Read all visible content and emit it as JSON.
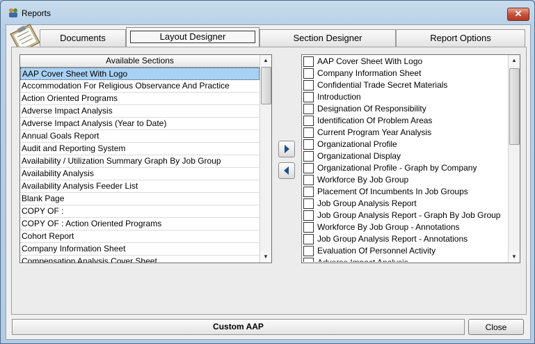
{
  "window": {
    "title": "Reports",
    "close_glyph": "✕"
  },
  "tabs": [
    {
      "label": "Documents",
      "active": false
    },
    {
      "label": "Layout Designer",
      "active": true
    },
    {
      "label": "Section Designer",
      "active": false
    },
    {
      "label": "Report Options",
      "active": false
    }
  ],
  "available": {
    "header": "Available Sections",
    "items": [
      "AAP Cover Sheet With Logo",
      "Accommodation For Religious Observance And Practice",
      "Action Oriented Programs",
      "Adverse Impact Analysis",
      "Adverse Impact Analysis (Year to Date)",
      "Annual Goals Report",
      "Audit and Reporting System",
      "Availability / Utilization Summary Graph By Job Group",
      "Availability Analysis",
      "Availability Analysis Feeder List",
      "Blank Page",
      "COPY OF :",
      "COPY OF : Action Oriented Programs",
      "Cohort Report",
      "Company Information Sheet",
      "Compensation Analysis Cover Sheet"
    ],
    "selected_index": 0
  },
  "selected": {
    "items": [
      "AAP Cover Sheet With Logo",
      "Company Information Sheet",
      "Confidential Trade Secret Materials",
      "Introduction",
      "Designation Of Responsibility",
      "Identification Of Problem Areas",
      "Current Program Year Analysis",
      "Organizational Profile",
      "Organizational Display",
      "Organizational Profile  - Graph by Company",
      "Workforce By Job Group",
      "Placement Of Incumbents In Job Groups",
      "Job Group Analysis Report",
      "Job Group Analysis Report  - Graph By Job Group",
      "Workforce By Job Group - Annotations",
      "Job Group Analysis Report - Annotations",
      "Evaluation Of Personnel Activity",
      "Adverse Impact Analysis"
    ]
  },
  "buttons": {
    "add_icon": "arrow-right-icon",
    "remove_icon": "arrow-left-icon",
    "custom_aap": "Custom AAP",
    "close": "Close"
  },
  "colors": {
    "selection": "#a8d1f5",
    "arrow": "#1c4f8f"
  }
}
